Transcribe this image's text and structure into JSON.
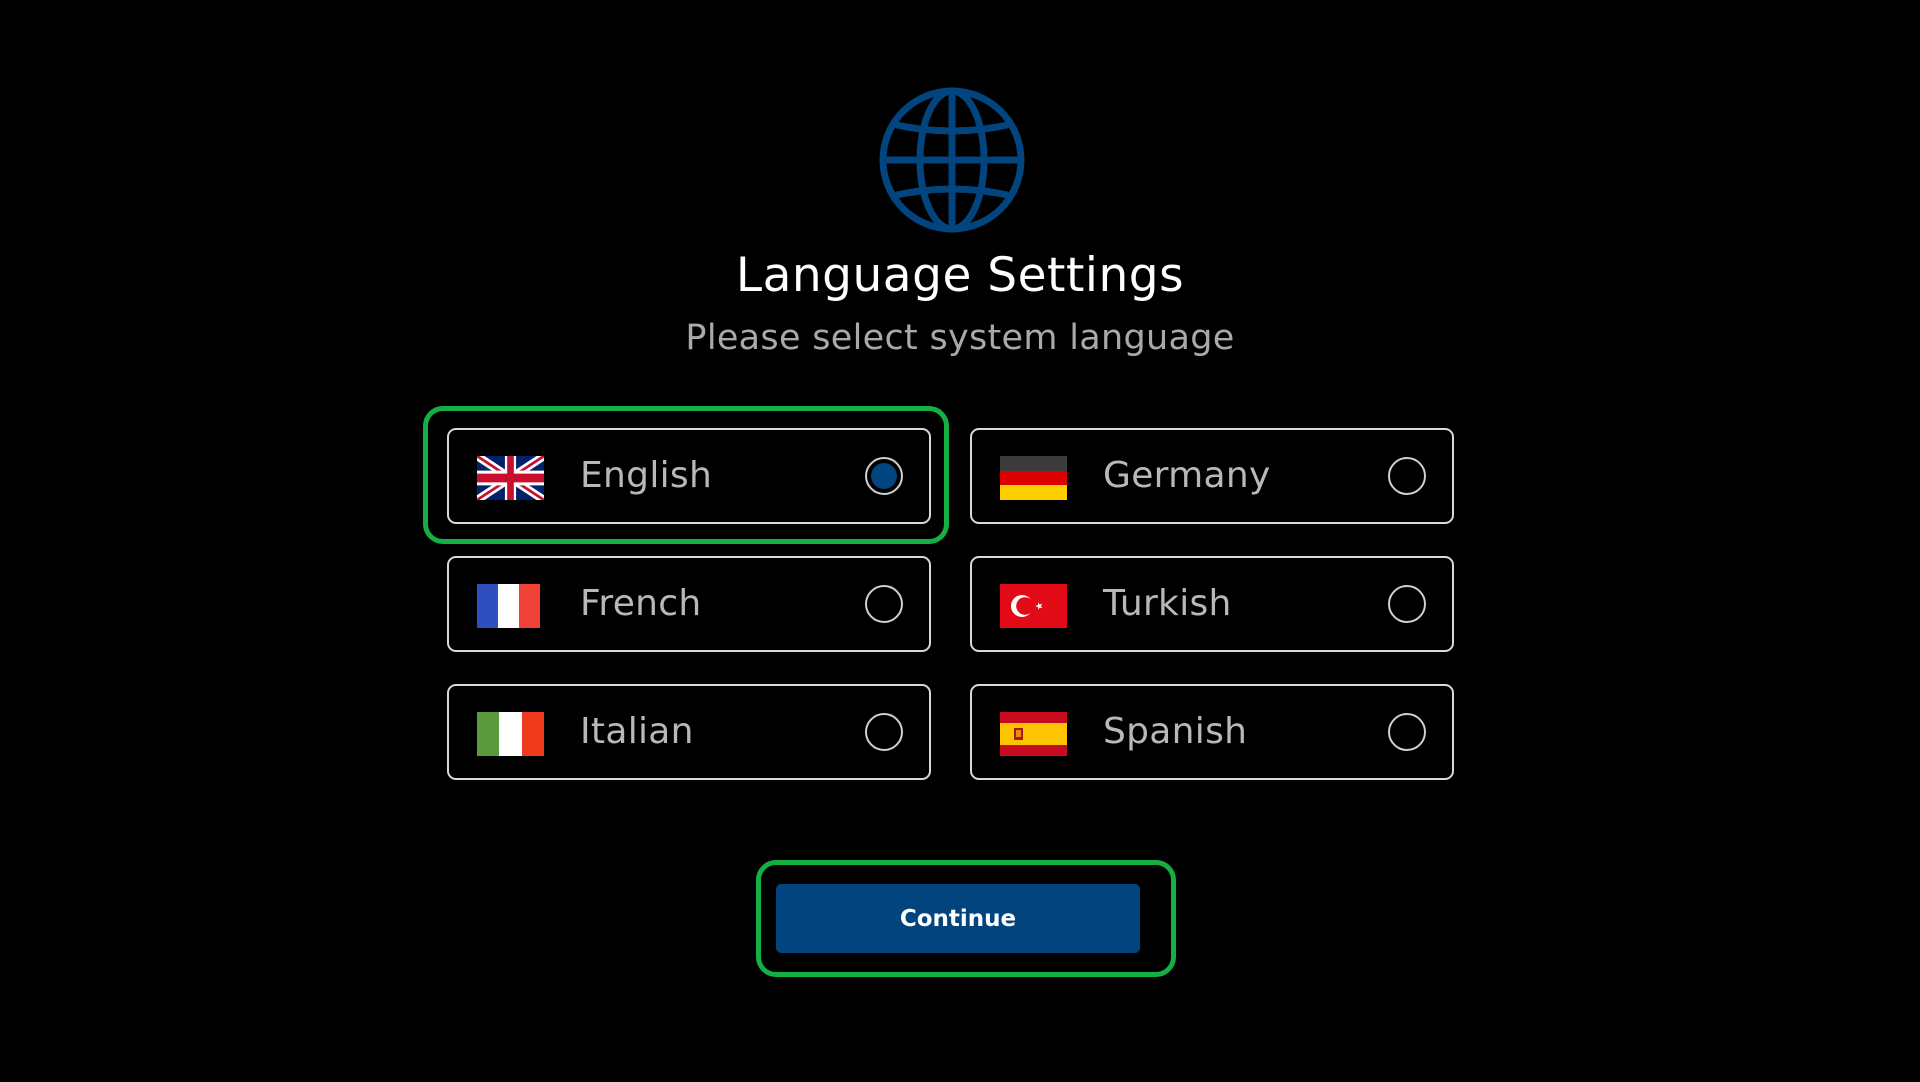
{
  "header": {
    "icon": "globe-icon",
    "title": "Language Settings",
    "subtitle": "Please select system language"
  },
  "languages": [
    {
      "label": "English",
      "flag": "uk-flag-icon",
      "selected": true
    },
    {
      "label": "Germany",
      "flag": "germany-flag-icon",
      "selected": false
    },
    {
      "label": "French",
      "flag": "france-flag-icon",
      "selected": false
    },
    {
      "label": "Turkish",
      "flag": "turkey-flag-icon",
      "selected": false
    },
    {
      "label": "Italian",
      "flag": "italy-flag-icon",
      "selected": false
    },
    {
      "label": "Spanish",
      "flag": "spain-flag-icon",
      "selected": false
    }
  ],
  "actions": {
    "continue_label": "Continue"
  },
  "colors": {
    "background": "#000000",
    "accent": "#02447e",
    "highlight": "#14b043",
    "title": "#ffffff",
    "subtitle": "#a9a9a9",
    "option_text": "#b8b8b8"
  }
}
